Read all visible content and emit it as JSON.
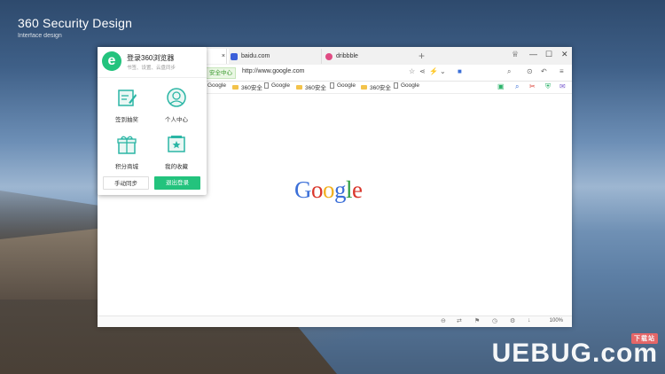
{
  "brand": {
    "title": "360 Security Design",
    "subtitle": "Interface design"
  },
  "watermark": {
    "text": "UEBUG.com",
    "badge": "下载站"
  },
  "tabs": [
    {
      "label": "×"
    },
    {
      "label": "baidu.com"
    },
    {
      "label": "dribbble"
    }
  ],
  "tabbar": {
    "new_tab": "+"
  },
  "address": {
    "security_badge": "安全中心",
    "url": "http://www.google.com"
  },
  "bookmarks": [
    "Google",
    "360安全",
    "Google",
    "360安全",
    "Google",
    "360安全",
    "Google"
  ],
  "status": {
    "zoom": "100%"
  },
  "google": {
    "letters": [
      "G",
      "o",
      "o",
      "g",
      "l",
      "e"
    ],
    "colors": [
      "#3b6fd8",
      "#d9362b",
      "#f2b01e",
      "#3b6fd8",
      "#2f9e44",
      "#d9362b"
    ]
  },
  "popup": {
    "title": "登录360浏览器",
    "subtitle": "书签、设置、云盘同步",
    "items": [
      {
        "label": "签到抽奖",
        "icon": "notepad-icon"
      },
      {
        "label": "个人中心",
        "icon": "user-icon"
      },
      {
        "label": "积分商城",
        "icon": "gift-icon"
      },
      {
        "label": "我的收藏",
        "icon": "favorites-icon"
      }
    ],
    "sync_button": "手动同步",
    "logout_button": "退出登录"
  },
  "colors": {
    "accent": "#23c37d"
  }
}
